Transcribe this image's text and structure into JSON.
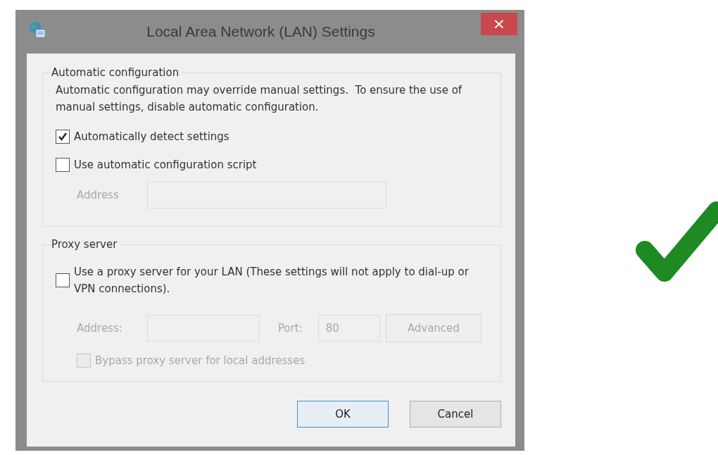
{
  "window": {
    "title": "Local Area Network (LAN) Settings",
    "close": "×"
  },
  "automatic_configuration": {
    "legend": "Automatic configuration",
    "description": "Automatic configuration may override manual settings.  To ensure the use of manual settings, disable automatic configuration.",
    "options": [
      {
        "label": "Automatically detect settings",
        "checked": true,
        "disabled": false
      },
      {
        "label": "Use automatic configuration script",
        "checked": false,
        "disabled": false
      }
    ],
    "address": {
      "label": "Address",
      "disabled": true
    }
  },
  "proxy_server": {
    "legend": "Proxy server",
    "option": {
      "label": "Use a proxy server for your LAN (These settings will not apply to dial-up or VPN connections).",
      "checked": false,
      "disabled": false
    },
    "address": {
      "label": "Address:",
      "disabled": true
    },
    "port": {
      "label": "Port:",
      "value": "80",
      "disabled": true
    },
    "advanced_button": {
      "label": "Advanced",
      "disabled": true
    },
    "bypass": {
      "label": "Bypass proxy server for local addresses",
      "checked": false,
      "disabled": true
    }
  },
  "buttons": [
    {
      "label": "OK",
      "default": true
    },
    {
      "label": "Cancel",
      "default": false
    }
  ]
}
